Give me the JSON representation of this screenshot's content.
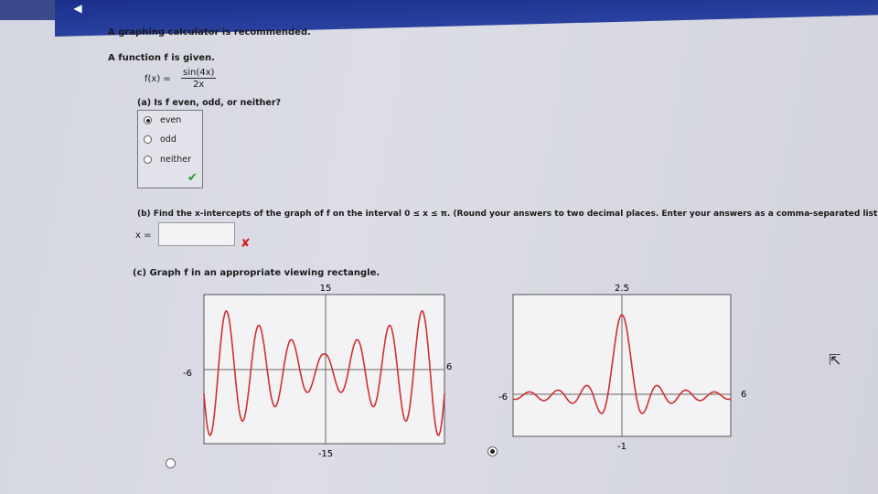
{
  "header": {
    "title_text": ""
  },
  "intro": {
    "recommend": "A graphing calculator is recommended.",
    "given": "A function f is given."
  },
  "formula": {
    "lhs": "f(x) =",
    "numerator": "sin(4x)",
    "denominator": "2x"
  },
  "part_a": {
    "question": "(a) Is f even, odd, or neither?",
    "options": [
      {
        "label": "even",
        "selected": true
      },
      {
        "label": "odd",
        "selected": false
      },
      {
        "label": "neither",
        "selected": false
      }
    ]
  },
  "part_b": {
    "question": "(b) Find the x-intercepts of the graph of f on the interval 0 ≤ x ≤ π. (Round your answers to two decimal places. Enter your answers as a comma-separated list.)",
    "input_label": "x =",
    "input_value": ""
  },
  "part_c": {
    "question": "(c) Graph f in an appropriate viewing rectangle.",
    "graph_left": {
      "top": "15",
      "bottom": "-15",
      "left": "-6",
      "right": "6",
      "selected": false
    },
    "graph_right": {
      "top": "2.5",
      "bottom": "-1",
      "left": "-6",
      "right": "6",
      "selected": true
    }
  },
  "colors": {
    "curve": "#d03030",
    "header": "#1c2f8c",
    "check": "#2a9a2a",
    "cross": "#d02020"
  }
}
